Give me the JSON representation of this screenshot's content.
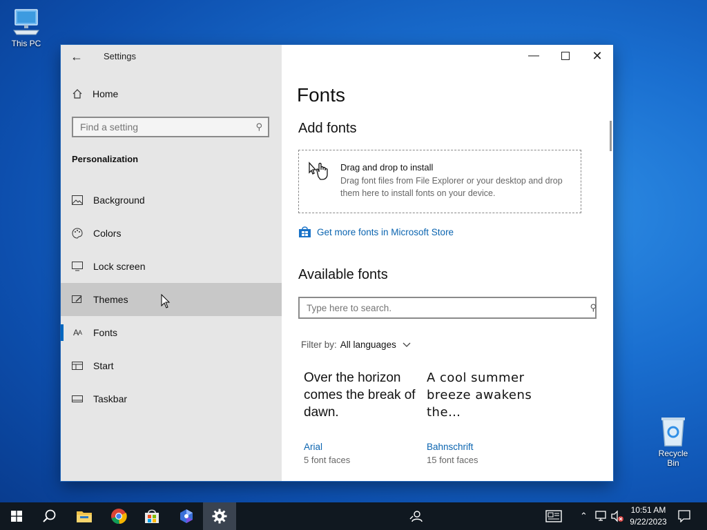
{
  "desktop": {
    "icons": [
      {
        "label": "This PC",
        "icon": "computer-icon"
      },
      {
        "label": "Recycle Bin",
        "icon": "recycle-bin-icon"
      }
    ]
  },
  "window": {
    "title": "Settings",
    "controls": {
      "minimize": "minimize-icon",
      "maximize": "maximize-icon",
      "close": "close-icon"
    }
  },
  "sidebar": {
    "home_label": "Home",
    "search_placeholder": "Find a setting",
    "section_heading": "Personalization",
    "items": [
      {
        "label": "Background",
        "icon": "image-icon",
        "state": "normal"
      },
      {
        "label": "Colors",
        "icon": "palette-icon",
        "state": "normal"
      },
      {
        "label": "Lock screen",
        "icon": "monitor-icon",
        "state": "normal"
      },
      {
        "label": "Themes",
        "icon": "brush-icon",
        "state": "hover"
      },
      {
        "label": "Fonts",
        "icon": "font-icon",
        "state": "selected"
      },
      {
        "label": "Start",
        "icon": "start-layout-icon",
        "state": "normal"
      },
      {
        "label": "Taskbar",
        "icon": "taskbar-icon",
        "state": "normal"
      }
    ]
  },
  "main": {
    "page_title": "Fonts",
    "add_fonts": {
      "heading": "Add fonts",
      "drop_title": "Drag and drop to install",
      "drop_text": "Drag font files from File Explorer or your desktop and drop them here to install fonts on your device."
    },
    "store_link": "Get more fonts in Microsoft Store",
    "available": {
      "heading": "Available fonts",
      "search_placeholder": "Type here to search.",
      "filter_label": "Filter by:",
      "filter_value": "All languages",
      "fonts": [
        {
          "sample": "Over the horizon comes the break of dawn.",
          "name": "Arial",
          "faces": "5 font faces"
        },
        {
          "sample": "A cool summer breeze awakens the…",
          "name": "Bahnschrift",
          "faces": "15 font faces"
        }
      ]
    }
  },
  "taskbar": {
    "apps": [
      "start-icon",
      "search-icon",
      "file-explorer-icon",
      "chrome-icon",
      "store-icon",
      "photos-icon",
      "settings-icon"
    ],
    "active_app": "settings-icon",
    "time": "10:51 AM",
    "date": "9/22/2023"
  },
  "colors": {
    "accent": "#0067c0",
    "link": "#0a64b0",
    "sidebar_bg": "#e6e6e6",
    "hover_bg": "#c8c8c8",
    "taskbar": "#101820"
  }
}
